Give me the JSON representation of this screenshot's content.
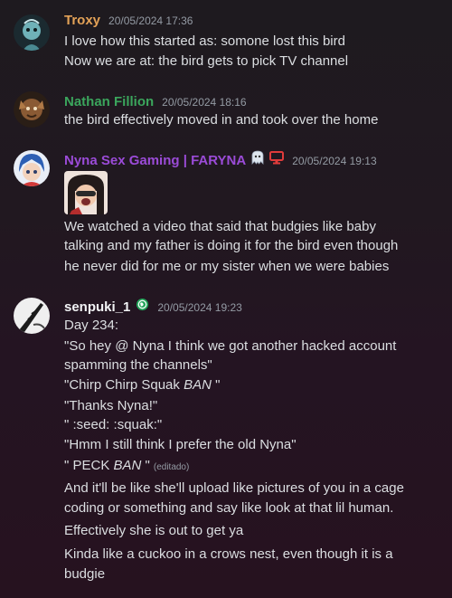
{
  "messages": [
    {
      "username": "Troxy",
      "timestamp": "20/05/2024 17:36",
      "color": "#e3a257",
      "lines": [
        "I love how this started as: somone lost this bird",
        "Now we are at: the bird gets to pick TV channel"
      ]
    },
    {
      "username": "Nathan Fillion",
      "timestamp": "20/05/2024 18:16",
      "color": "#3ba55c",
      "lines": [
        "the bird effectively moved in and took over the home"
      ]
    },
    {
      "username": "Nyna Sex Gaming | FARYNA",
      "timestamp": "20/05/2024 19:13",
      "color": "#9b4bd8",
      "badges": [
        "ghost-icon",
        "monitor-icon"
      ],
      "lines": [
        "We watched a video that said that budgies like baby",
        "talking and my father is doing it for the bird even though",
        "he never did for me or my sister when we were babies"
      ]
    },
    {
      "username": "senpuki_1",
      "timestamp": "20/05/2024 19:23",
      "color": "#f2f3f5",
      "badges": [
        "globe-icon"
      ],
      "lines": [
        "Day 234:",
        "\"So hey @ Nyna I think we got another hacked account",
        "spamming the channels\"",
        "\"Chirp Chirp Squak ",
        "BAN",
        " \"",
        "\"Thanks Nyna!\"",
        "\" :seed: :squak:\"",
        "\"Hmm I still think I prefer the old Nyna\"",
        "\" PECK ",
        "BAN",
        " \"",
        "(editado)",
        "And it'll be like she'll upload like pictures of you in a cage",
        "coding or something and say like look at that lil human.",
        "Effectively she is out to get ya",
        "Kinda like a cuckoo in a crows nest, even though it is a",
        "budgie"
      ]
    }
  ]
}
